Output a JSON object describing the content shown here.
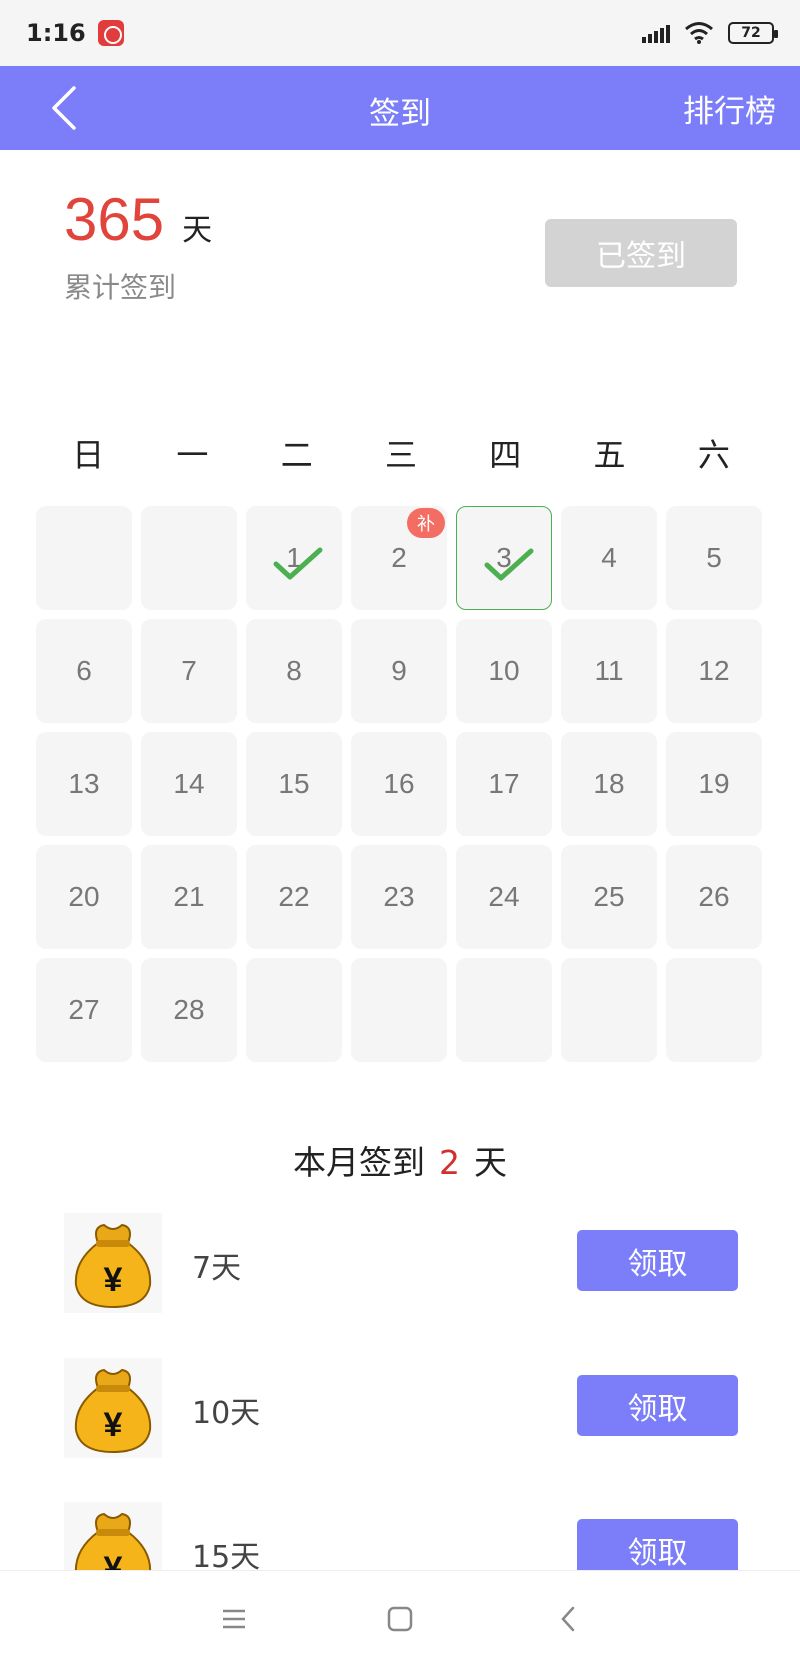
{
  "status_bar": {
    "time": "1:16",
    "battery": "72",
    "icons": [
      "app-notification-icon",
      "signal-icon",
      "wifi-icon",
      "battery-icon"
    ]
  },
  "app_bar": {
    "title": "签到",
    "right_action": "排行榜",
    "back_icon": "chevron-left-icon",
    "background": "#7b7ef8"
  },
  "summary": {
    "total_days": "365",
    "unit": "天",
    "label": "累计签到",
    "checkin_button": "已签到"
  },
  "calendar": {
    "weekdays": [
      "日",
      "一",
      "二",
      "三",
      "四",
      "五",
      "六"
    ],
    "days": [
      {
        "label": "",
        "empty": true
      },
      {
        "label": "",
        "empty": true
      },
      {
        "label": "1",
        "checked": true
      },
      {
        "label": "2",
        "badge": "补"
      },
      {
        "label": "3",
        "checked": true,
        "today": true
      },
      {
        "label": "4"
      },
      {
        "label": "5"
      },
      {
        "label": "6"
      },
      {
        "label": "7"
      },
      {
        "label": "8"
      },
      {
        "label": "9"
      },
      {
        "label": "10"
      },
      {
        "label": "11"
      },
      {
        "label": "12"
      },
      {
        "label": "13"
      },
      {
        "label": "14"
      },
      {
        "label": "15"
      },
      {
        "label": "16"
      },
      {
        "label": "17"
      },
      {
        "label": "18"
      },
      {
        "label": "19"
      },
      {
        "label": "20"
      },
      {
        "label": "21"
      },
      {
        "label": "22"
      },
      {
        "label": "23"
      },
      {
        "label": "24"
      },
      {
        "label": "25"
      },
      {
        "label": "26"
      },
      {
        "label": "27"
      },
      {
        "label": "28"
      },
      {
        "label": "",
        "empty": true
      },
      {
        "label": "",
        "empty": true
      },
      {
        "label": "",
        "empty": true
      },
      {
        "label": "",
        "empty": true
      },
      {
        "label": "",
        "empty": true
      }
    ],
    "check_color": "#4caf50",
    "badge_color": "#f36d62"
  },
  "month_summary": {
    "prefix": "本月签到",
    "count": "2",
    "suffix": "天"
  },
  "rewards": [
    {
      "label": "7天",
      "button": "领取",
      "icon": "money-bag-icon"
    },
    {
      "label": "10天",
      "button": "领取",
      "icon": "money-bag-icon"
    },
    {
      "label": "15天",
      "button": "领取",
      "icon": "money-bag-icon"
    }
  ],
  "nav_bar": {
    "icons": [
      "menu-icon",
      "home-square-icon",
      "back-chevron-icon"
    ]
  }
}
